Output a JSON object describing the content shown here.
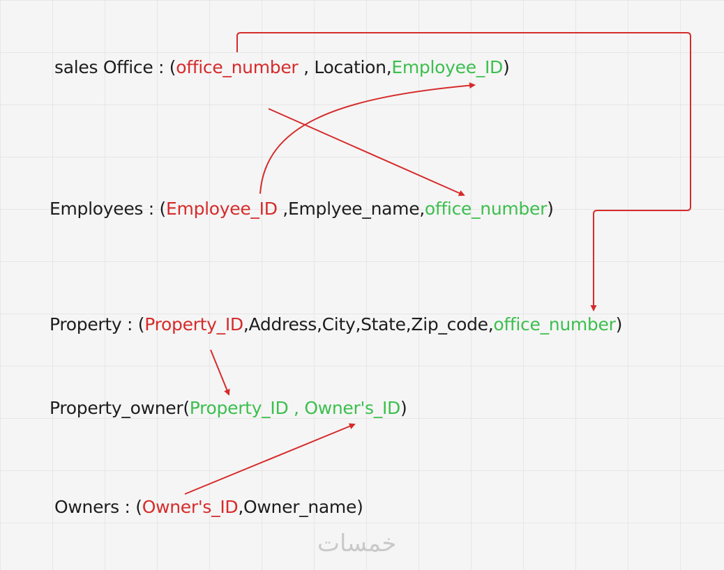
{
  "relations": {
    "sales_office": {
      "prefix": "sales Office : (",
      "pk": "office_number",
      "mid": " , Location,",
      "fk": "Employee_ID",
      "suffix": ")"
    },
    "employees": {
      "prefix": "Employees : (",
      "pk": "Employee_ID",
      "mid": " ,Emplyee_name,",
      "fk": "office_number",
      "suffix": ")"
    },
    "property": {
      "prefix": "Property : (",
      "pk": "Property_ID",
      "mid": ",Address,City,State,Zip_code,",
      "fk": "office_number",
      "suffix": ")"
    },
    "property_owner": {
      "prefix": "Property_owner(",
      "fk": "Property_ID , Owner's_ID",
      "suffix": ")"
    },
    "owners": {
      "prefix": "Owners : (",
      "pk": "Owner's_ID",
      "suffix": ",Owner_name)"
    }
  },
  "colors": {
    "primary_key": "#d62b2b",
    "foreign_key": "#3cbf4e",
    "arrow": "#d62b2b",
    "text": "#1d1d1d"
  },
  "watermark": "خمسات"
}
